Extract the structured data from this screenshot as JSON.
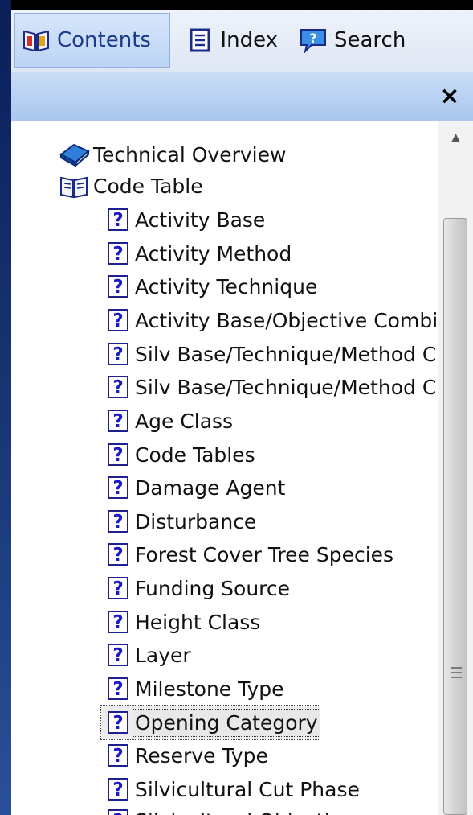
{
  "tabs": [
    {
      "label": "Contents",
      "icon": "book-icon",
      "selected": true
    },
    {
      "label": "Index",
      "icon": "index-icon",
      "selected": false
    },
    {
      "label": "Search",
      "icon": "search-speech-icon",
      "selected": false
    }
  ],
  "close_label": "×",
  "tree": {
    "top_items": [
      {
        "label": "Technical Overview",
        "icon": "closed-book-icon"
      },
      {
        "label": "Code Table",
        "icon": "open-book-icon"
      }
    ],
    "children": [
      {
        "label": "Activity Base"
      },
      {
        "label": "Activity Method"
      },
      {
        "label": "Activity Technique"
      },
      {
        "label": "Activity Base/Objective Combi"
      },
      {
        "label": "Silv Base/Technique/Method C"
      },
      {
        "label": "Silv Base/Technique/Method C"
      },
      {
        "label": "Age Class"
      },
      {
        "label": "Code Tables"
      },
      {
        "label": "Damage Agent"
      },
      {
        "label": "Disturbance"
      },
      {
        "label": "Forest Cover Tree Species"
      },
      {
        "label": "Funding Source"
      },
      {
        "label": "Height Class"
      },
      {
        "label": "Layer"
      },
      {
        "label": "Milestone Type"
      },
      {
        "label": "Opening Category",
        "selected": true
      },
      {
        "label": "Reserve Type"
      },
      {
        "label": "Silvicultural Cut Phase"
      },
      {
        "label": "Silvicultural Objective"
      }
    ],
    "topic_icon_glyph": "?"
  },
  "scrollbar": {
    "up_arrow": "▲"
  },
  "colors": {
    "tab_selected_text": "#1b3b8a",
    "question_icon": "#1a1ac9",
    "header_strip": "#b5cff2"
  }
}
